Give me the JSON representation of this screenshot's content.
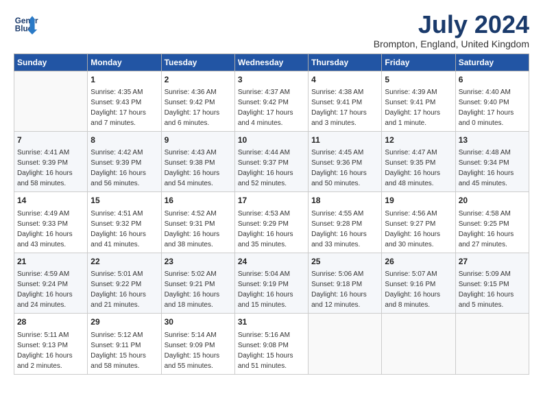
{
  "header": {
    "logo_line1": "General",
    "logo_line2": "Blue",
    "main_title": "July 2024",
    "subtitle": "Brompton, England, United Kingdom"
  },
  "days_of_week": [
    "Sunday",
    "Monday",
    "Tuesday",
    "Wednesday",
    "Thursday",
    "Friday",
    "Saturday"
  ],
  "weeks": [
    [
      {
        "day": "",
        "info": ""
      },
      {
        "day": "1",
        "info": "Sunrise: 4:35 AM\nSunset: 9:43 PM\nDaylight: 17 hours\nand 7 minutes."
      },
      {
        "day": "2",
        "info": "Sunrise: 4:36 AM\nSunset: 9:42 PM\nDaylight: 17 hours\nand 6 minutes."
      },
      {
        "day": "3",
        "info": "Sunrise: 4:37 AM\nSunset: 9:42 PM\nDaylight: 17 hours\nand 4 minutes."
      },
      {
        "day": "4",
        "info": "Sunrise: 4:38 AM\nSunset: 9:41 PM\nDaylight: 17 hours\nand 3 minutes."
      },
      {
        "day": "5",
        "info": "Sunrise: 4:39 AM\nSunset: 9:41 PM\nDaylight: 17 hours\nand 1 minute."
      },
      {
        "day": "6",
        "info": "Sunrise: 4:40 AM\nSunset: 9:40 PM\nDaylight: 17 hours\nand 0 minutes."
      }
    ],
    [
      {
        "day": "7",
        "info": "Sunrise: 4:41 AM\nSunset: 9:39 PM\nDaylight: 16 hours\nand 58 minutes."
      },
      {
        "day": "8",
        "info": "Sunrise: 4:42 AM\nSunset: 9:39 PM\nDaylight: 16 hours\nand 56 minutes."
      },
      {
        "day": "9",
        "info": "Sunrise: 4:43 AM\nSunset: 9:38 PM\nDaylight: 16 hours\nand 54 minutes."
      },
      {
        "day": "10",
        "info": "Sunrise: 4:44 AM\nSunset: 9:37 PM\nDaylight: 16 hours\nand 52 minutes."
      },
      {
        "day": "11",
        "info": "Sunrise: 4:45 AM\nSunset: 9:36 PM\nDaylight: 16 hours\nand 50 minutes."
      },
      {
        "day": "12",
        "info": "Sunrise: 4:47 AM\nSunset: 9:35 PM\nDaylight: 16 hours\nand 48 minutes."
      },
      {
        "day": "13",
        "info": "Sunrise: 4:48 AM\nSunset: 9:34 PM\nDaylight: 16 hours\nand 45 minutes."
      }
    ],
    [
      {
        "day": "14",
        "info": "Sunrise: 4:49 AM\nSunset: 9:33 PM\nDaylight: 16 hours\nand 43 minutes."
      },
      {
        "day": "15",
        "info": "Sunrise: 4:51 AM\nSunset: 9:32 PM\nDaylight: 16 hours\nand 41 minutes."
      },
      {
        "day": "16",
        "info": "Sunrise: 4:52 AM\nSunset: 9:31 PM\nDaylight: 16 hours\nand 38 minutes."
      },
      {
        "day": "17",
        "info": "Sunrise: 4:53 AM\nSunset: 9:29 PM\nDaylight: 16 hours\nand 35 minutes."
      },
      {
        "day": "18",
        "info": "Sunrise: 4:55 AM\nSunset: 9:28 PM\nDaylight: 16 hours\nand 33 minutes."
      },
      {
        "day": "19",
        "info": "Sunrise: 4:56 AM\nSunset: 9:27 PM\nDaylight: 16 hours\nand 30 minutes."
      },
      {
        "day": "20",
        "info": "Sunrise: 4:58 AM\nSunset: 9:25 PM\nDaylight: 16 hours\nand 27 minutes."
      }
    ],
    [
      {
        "day": "21",
        "info": "Sunrise: 4:59 AM\nSunset: 9:24 PM\nDaylight: 16 hours\nand 24 minutes."
      },
      {
        "day": "22",
        "info": "Sunrise: 5:01 AM\nSunset: 9:22 PM\nDaylight: 16 hours\nand 21 minutes."
      },
      {
        "day": "23",
        "info": "Sunrise: 5:02 AM\nSunset: 9:21 PM\nDaylight: 16 hours\nand 18 minutes."
      },
      {
        "day": "24",
        "info": "Sunrise: 5:04 AM\nSunset: 9:19 PM\nDaylight: 16 hours\nand 15 minutes."
      },
      {
        "day": "25",
        "info": "Sunrise: 5:06 AM\nSunset: 9:18 PM\nDaylight: 16 hours\nand 12 minutes."
      },
      {
        "day": "26",
        "info": "Sunrise: 5:07 AM\nSunset: 9:16 PM\nDaylight: 16 hours\nand 8 minutes."
      },
      {
        "day": "27",
        "info": "Sunrise: 5:09 AM\nSunset: 9:15 PM\nDaylight: 16 hours\nand 5 minutes."
      }
    ],
    [
      {
        "day": "28",
        "info": "Sunrise: 5:11 AM\nSunset: 9:13 PM\nDaylight: 16 hours\nand 2 minutes."
      },
      {
        "day": "29",
        "info": "Sunrise: 5:12 AM\nSunset: 9:11 PM\nDaylight: 15 hours\nand 58 minutes."
      },
      {
        "day": "30",
        "info": "Sunrise: 5:14 AM\nSunset: 9:09 PM\nDaylight: 15 hours\nand 55 minutes."
      },
      {
        "day": "31",
        "info": "Sunrise: 5:16 AM\nSunset: 9:08 PM\nDaylight: 15 hours\nand 51 minutes."
      },
      {
        "day": "",
        "info": ""
      },
      {
        "day": "",
        "info": ""
      },
      {
        "day": "",
        "info": ""
      }
    ]
  ]
}
